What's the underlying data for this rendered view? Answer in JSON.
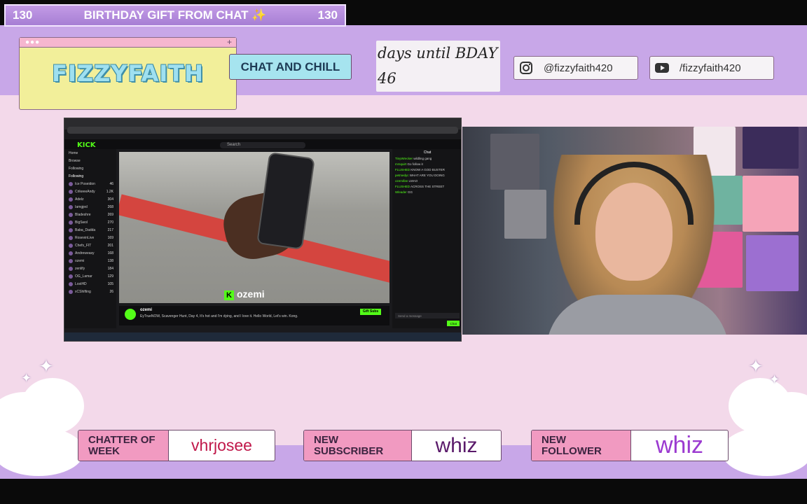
{
  "goal": {
    "left_count": "130",
    "title": "BIRTHDAY GIFT FROM CHAT ✨",
    "right_count": "130"
  },
  "logo": {
    "text": "FIZZYFAITH"
  },
  "chill_button": "CHAT AND CHILL",
  "bday_countdown": {
    "line1": "days until BDAY",
    "line2": "46"
  },
  "socials": [
    {
      "icon": "instagram-icon",
      "handle": "@fizzyfaith420"
    },
    {
      "icon": "youtube-icon",
      "handle": "/fizzyfaith420"
    }
  ],
  "screen_capture": {
    "site_logo": "KICK",
    "search_placeholder": "Search",
    "nav": [
      "Home",
      "Browse",
      "Following"
    ],
    "following_header": "Following",
    "following": [
      {
        "name": "Ice Poseidon",
        "count": "46"
      },
      {
        "name": "CrikeeeAndy",
        "count": "1.2K"
      },
      {
        "name": "Adelz",
        "count": "304"
      },
      {
        "name": "Iamgjed",
        "count": "268"
      },
      {
        "name": "Bladeshre",
        "count": "269"
      },
      {
        "name": "BigSwol",
        "count": "270"
      },
      {
        "name": "Baba_Dadda",
        "count": "217"
      },
      {
        "name": "RosevinLive",
        "count": "169"
      },
      {
        "name": "Chefs_FIT",
        "count": "201"
      },
      {
        "name": "Andreweasy",
        "count": "168"
      },
      {
        "name": "ozemi",
        "count": "138"
      },
      {
        "name": "zenlify",
        "count": "184"
      },
      {
        "name": "OG_Lamar",
        "count": "129"
      },
      {
        "name": "LostHD",
        "count": "105"
      },
      {
        "name": "xCShifting",
        "count": "26"
      }
    ],
    "video_overlay_name": "ozemi",
    "streamer_name": "ozemi",
    "stream_title": "EyTrueNOW, Scavenger Hunt, Day 4, It's hot and I'm dying, and I love it. Hello World, Let's win. Kong.",
    "follow_label": "Gift Subs",
    "chat_header": "Chat",
    "chat_lines": [
      {
        "user": "TinyWrecker",
        "text": "wildling gang"
      },
      {
        "user": "mrsquirt",
        "text": "Go follow it"
      },
      {
        "user": "FLUSHED",
        "text": "KNOW A GOD BUSTER"
      },
      {
        "user": "petmedyc",
        "text": "WHAT ARE YOU DOING"
      },
      {
        "user": "ozemifan",
        "text": "LMAO"
      },
      {
        "user": "FLUSHED",
        "text": "ACROSS THE STREET"
      },
      {
        "user": "Wleader",
        "text": "GG"
      }
    ],
    "chat_input_placeholder": "Send a message",
    "chat_send": "Chat"
  },
  "stats": {
    "chatter": {
      "label": "CHATTER OF WEEK",
      "value": "vhrjosee"
    },
    "subscriber": {
      "label": "NEW SUBSCRIBER",
      "value": "whiz"
    },
    "follower": {
      "label": "NEW FOLLOWER",
      "value": "whiz"
    }
  },
  "colors": {
    "lavender": "#c8a7e8",
    "pink_bg": "#f3d9ea",
    "label_pink": "#f19ac1",
    "cyan_button": "#a6e4ef",
    "logo_yellow": "#f2ef9a",
    "kick_green": "#53fc18"
  }
}
